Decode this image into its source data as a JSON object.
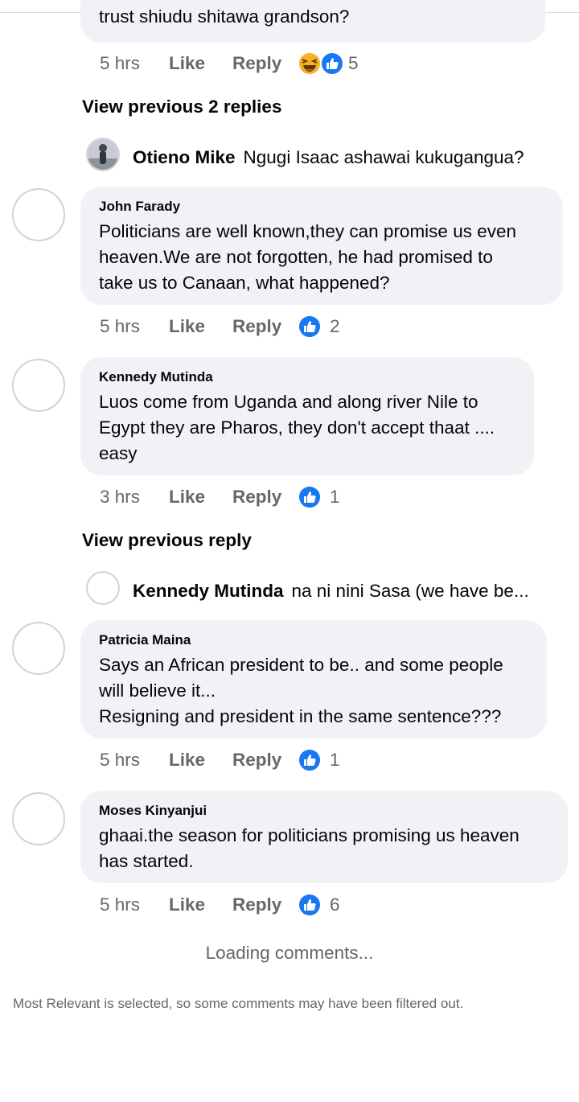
{
  "top_comment": {
    "text": "trust shiudu shitawa grandson?",
    "time": "5 hrs",
    "like": "Like",
    "reply": "Reply",
    "reactions": [
      "haha",
      "like"
    ],
    "count": "5"
  },
  "view_prev_1": "View previous 2 replies",
  "reply_preview_1": {
    "name": "Otieno Mike",
    "text": "Ngugi Isaac ashawai kukugangua?"
  },
  "comments": [
    {
      "author": "John Farady",
      "lines": [
        "Politicians are well known,they can promise us even",
        "heaven.We are not forgotten, he had promised to",
        "take us to Canaan, what happened?"
      ],
      "time": "5 hrs",
      "like": "Like",
      "reply": "Reply",
      "count": "2"
    },
    {
      "author": "Kennedy Mutinda",
      "lines": [
        "Luos come from Uganda and along river Nile to",
        "Egypt they are Pharos, they don't accept thaat ....",
        "easy"
      ],
      "time": "3 hrs",
      "like": "Like",
      "reply": "Reply",
      "count": "1"
    },
    {
      "author": "Patricia Maina",
      "lines": [
        "Says an African president to be.. and some people",
        "will believe it...",
        "Resigning and president in the same sentence???"
      ],
      "time": "5 hrs",
      "like": "Like",
      "reply": "Reply",
      "count": "1"
    },
    {
      "author": "Moses Kinyanjui",
      "lines": [
        "ghaai.the season for politicians promising us heaven",
        "has started."
      ],
      "time": "5 hrs",
      "like": "Like",
      "reply": "Reply",
      "count": "6"
    }
  ],
  "view_prev_2": "View previous reply",
  "reply_preview_2": {
    "name": "Kennedy Mutinda",
    "text": "na ni nini Sasa (we have be..."
  },
  "loading": "Loading comments...",
  "footnote": "Most Relevant is selected, so some comments may have been filtered out.",
  "colors": {
    "like_blue": "#1877f2",
    "bubble": "#f0f2f5",
    "secondary": "#65676b",
    "haha_yellow": "#f7b125"
  }
}
